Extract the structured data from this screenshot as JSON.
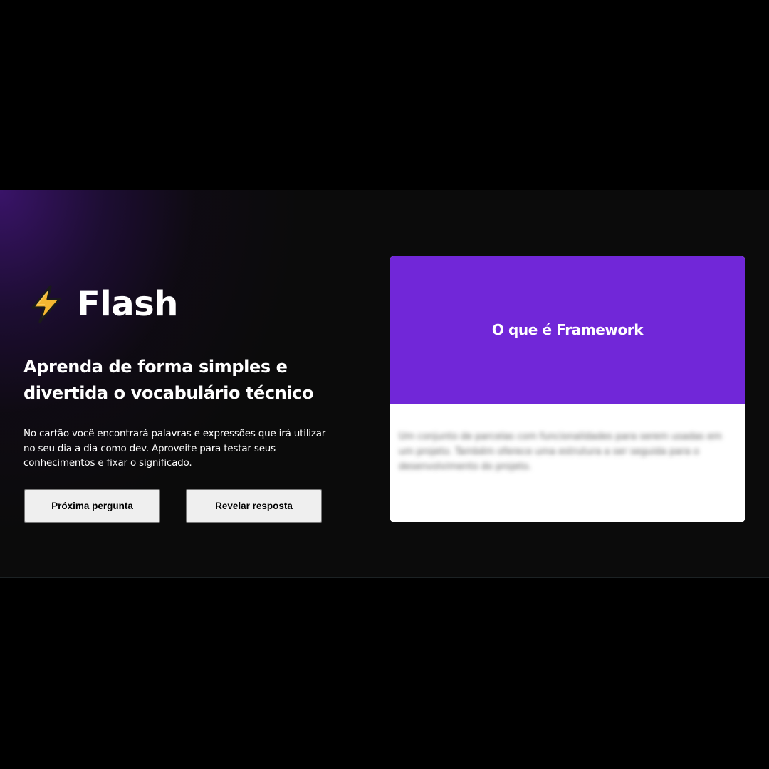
{
  "app": {
    "logo_text": "Flash",
    "logo_icon": "lightning-bolt-icon"
  },
  "hero": {
    "headline": "Aprenda de forma simples e divertida o vocabulário técnico",
    "description": "No cartão você encontrará palavras e expressões que irá utilizar no seu dia a dia como dev. Aproveite para testar seus conhecimentos e fixar o significado."
  },
  "actions": {
    "next_question_label": "Próxima pergunta",
    "reveal_answer_label": "Revelar resposta"
  },
  "card": {
    "question": "O que é Framework",
    "answer": "Um conjunto de parcelas com funcionalidades para serem usadas em um projeto. Também oferece uma estrutura a ser seguida para o desenvolvimento do projeto.",
    "answer_hidden": true
  },
  "colors": {
    "card_front": "#7127d8",
    "card_back": "#ffffff",
    "background": "#0b0b0b",
    "accent_glow": "#3c146e",
    "bolt_fill": "#f5b731",
    "bolt_stroke": "#1a1a1a"
  }
}
